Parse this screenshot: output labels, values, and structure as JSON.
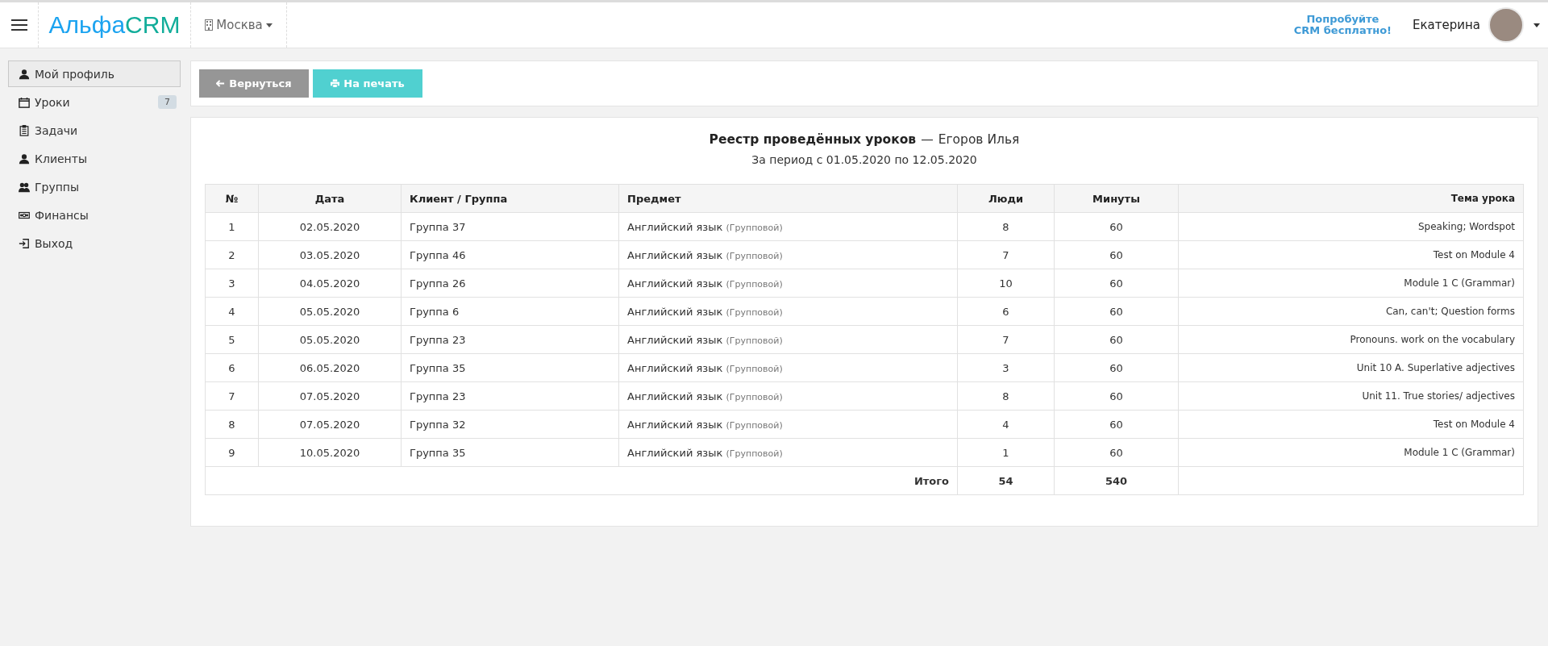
{
  "header": {
    "logo": {
      "part1": "Альфа",
      "part2": "CRM"
    },
    "branch": "Москва",
    "promo": [
      "Попробуйте",
      "CRM бесплатно!"
    ],
    "user": "Екатерина"
  },
  "sidebar": {
    "items": [
      {
        "label": "Мой профиль",
        "kind": "user",
        "selected": true
      },
      {
        "label": "Уроки",
        "kind": "calendar",
        "selected": false,
        "badge": "7"
      },
      {
        "label": "Задачи",
        "kind": "clipboard",
        "selected": false
      },
      {
        "label": "Клиенты",
        "kind": "user",
        "selected": false
      },
      {
        "label": "Группы",
        "kind": "users",
        "selected": false
      },
      {
        "label": "Финансы",
        "kind": "money",
        "selected": false
      },
      {
        "label": "Выход",
        "kind": "logout",
        "selected": false
      }
    ]
  },
  "toolbar": {
    "buttons": [
      {
        "label": "Вернуться",
        "kind": "back",
        "disabled": true
      },
      {
        "label": "На печать",
        "kind": "print",
        "disabled": false
      }
    ]
  },
  "report": {
    "title": "Реестр проведённых уроков",
    "separator": "—",
    "person": "Егоров Илья",
    "period": "За период с 01.05.2020 по 12.05.2020"
  },
  "table": {
    "columns": [
      "№",
      "Дата",
      "Клиент / Группа",
      "Предмет",
      "Люди",
      "Минуты",
      "Тема урока"
    ],
    "rows": [
      {
        "n": "1",
        "date": "02.05.2020",
        "client": "Группа 37",
        "subject": "Английский язык",
        "type": "(Групповой)",
        "people": "8",
        "minutes": "60",
        "topic": "Speaking; Wordspot"
      },
      {
        "n": "2",
        "date": "03.05.2020",
        "client": "Группа 46",
        "subject": "Английский язык",
        "type": "(Групповой)",
        "people": "7",
        "minutes": "60",
        "topic": "Test on Module 4"
      },
      {
        "n": "3",
        "date": "04.05.2020",
        "client": "Группа 26",
        "subject": "Английский язык",
        "type": "(Групповой)",
        "people": "10",
        "minutes": "60",
        "topic": "Module 1 C (Grammar)"
      },
      {
        "n": "4",
        "date": "05.05.2020",
        "client": "Группа 6",
        "subject": "Английский язык",
        "type": "(Групповой)",
        "people": "6",
        "minutes": "60",
        "topic": "Can, can't; Question forms"
      },
      {
        "n": "5",
        "date": "05.05.2020",
        "client": "Группа 23",
        "subject": "Английский язык",
        "type": "(Групповой)",
        "people": "7",
        "minutes": "60",
        "topic": "Pronouns. work on the vocabulary"
      },
      {
        "n": "6",
        "date": "06.05.2020",
        "client": "Группа 35",
        "subject": "Английский язык",
        "type": "(Групповой)",
        "people": "3",
        "minutes": "60",
        "topic": "Unit 10 A. Superlative adjectives"
      },
      {
        "n": "7",
        "date": "07.05.2020",
        "client": "Группа 23",
        "subject": "Английский язык",
        "type": "(Групповой)",
        "people": "8",
        "minutes": "60",
        "topic": "Unit 11. True stories/ adjectives"
      },
      {
        "n": "8",
        "date": "07.05.2020",
        "client": "Группа 32",
        "subject": "Английский язык",
        "type": "(Групповой)",
        "people": "4",
        "minutes": "60",
        "topic": "Test on Module 4"
      },
      {
        "n": "9",
        "date": "10.05.2020",
        "client": "Группа 35",
        "subject": "Английский язык",
        "type": "(Групповой)",
        "people": "1",
        "minutes": "60",
        "topic": "Module 1 C (Grammar)"
      }
    ],
    "total": {
      "label": "Итого",
      "people": "54",
      "minutes": "540"
    }
  }
}
